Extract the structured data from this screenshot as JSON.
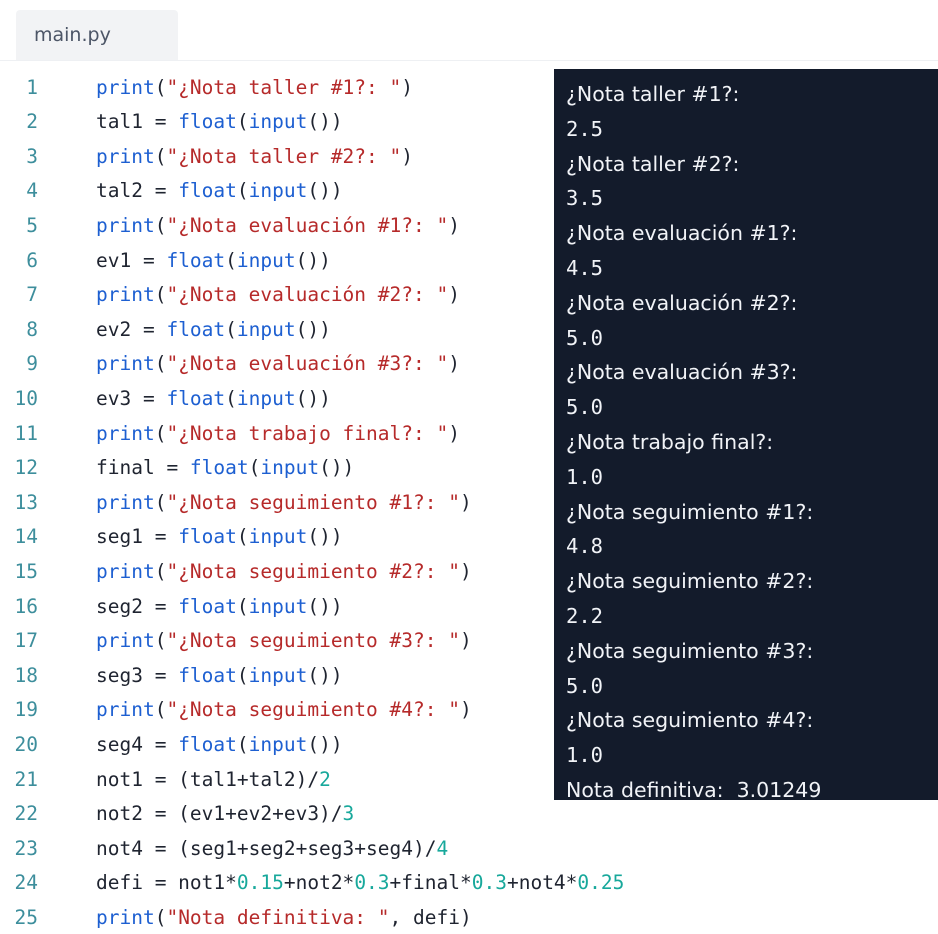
{
  "tab": {
    "filename": "main.py"
  },
  "editor": {
    "lines": [
      {
        "n": "1",
        "code": [
          {
            "t": "print",
            "c": "f"
          },
          {
            "t": "(",
            "c": ""
          },
          {
            "t": "\"¿Nota taller #1?: \"",
            "c": "s"
          },
          {
            "t": ")",
            "c": ""
          }
        ]
      },
      {
        "n": "2",
        "code": [
          {
            "t": "tal1 = ",
            "c": ""
          },
          {
            "t": "float",
            "c": "f"
          },
          {
            "t": "(",
            "c": ""
          },
          {
            "t": "input",
            "c": "f"
          },
          {
            "t": "())",
            "c": ""
          }
        ]
      },
      {
        "n": "3",
        "code": [
          {
            "t": "print",
            "c": "f"
          },
          {
            "t": "(",
            "c": ""
          },
          {
            "t": "\"¿Nota taller #2?: \"",
            "c": "s"
          },
          {
            "t": ")",
            "c": ""
          }
        ]
      },
      {
        "n": "4",
        "code": [
          {
            "t": "tal2 = ",
            "c": ""
          },
          {
            "t": "float",
            "c": "f"
          },
          {
            "t": "(",
            "c": ""
          },
          {
            "t": "input",
            "c": "f"
          },
          {
            "t": "())",
            "c": ""
          }
        ]
      },
      {
        "n": "5",
        "code": [
          {
            "t": "print",
            "c": "f"
          },
          {
            "t": "(",
            "c": ""
          },
          {
            "t": "\"¿Nota evaluación #1?: \"",
            "c": "s"
          },
          {
            "t": ")",
            "c": ""
          }
        ]
      },
      {
        "n": "6",
        "code": [
          {
            "t": "ev1 = ",
            "c": ""
          },
          {
            "t": "float",
            "c": "f"
          },
          {
            "t": "(",
            "c": ""
          },
          {
            "t": "input",
            "c": "f"
          },
          {
            "t": "())",
            "c": ""
          }
        ]
      },
      {
        "n": "7",
        "code": [
          {
            "t": "print",
            "c": "f"
          },
          {
            "t": "(",
            "c": ""
          },
          {
            "t": "\"¿Nota evaluación #2?: \"",
            "c": "s"
          },
          {
            "t": ")",
            "c": ""
          }
        ]
      },
      {
        "n": "8",
        "code": [
          {
            "t": "ev2 = ",
            "c": ""
          },
          {
            "t": "float",
            "c": "f"
          },
          {
            "t": "(",
            "c": ""
          },
          {
            "t": "input",
            "c": "f"
          },
          {
            "t": "())",
            "c": ""
          }
        ]
      },
      {
        "n": "9",
        "code": [
          {
            "t": "print",
            "c": "f"
          },
          {
            "t": "(",
            "c": ""
          },
          {
            "t": "\"¿Nota evaluación #3?: \"",
            "c": "s"
          },
          {
            "t": ")",
            "c": ""
          }
        ]
      },
      {
        "n": "10",
        "code": [
          {
            "t": "ev3 = ",
            "c": ""
          },
          {
            "t": "float",
            "c": "f"
          },
          {
            "t": "(",
            "c": ""
          },
          {
            "t": "input",
            "c": "f"
          },
          {
            "t": "())",
            "c": ""
          }
        ]
      },
      {
        "n": "11",
        "code": [
          {
            "t": "print",
            "c": "f"
          },
          {
            "t": "(",
            "c": ""
          },
          {
            "t": "\"¿Nota trabajo final?: \"",
            "c": "s"
          },
          {
            "t": ")",
            "c": ""
          }
        ]
      },
      {
        "n": "12",
        "code": [
          {
            "t": "final = ",
            "c": ""
          },
          {
            "t": "float",
            "c": "f"
          },
          {
            "t": "(",
            "c": ""
          },
          {
            "t": "input",
            "c": "f"
          },
          {
            "t": "())",
            "c": ""
          }
        ]
      },
      {
        "n": "13",
        "code": [
          {
            "t": "print",
            "c": "f"
          },
          {
            "t": "(",
            "c": ""
          },
          {
            "t": "\"¿Nota seguimiento #1?: \"",
            "c": "s"
          },
          {
            "t": ")",
            "c": ""
          }
        ]
      },
      {
        "n": "14",
        "code": [
          {
            "t": "seg1 = ",
            "c": ""
          },
          {
            "t": "float",
            "c": "f"
          },
          {
            "t": "(",
            "c": ""
          },
          {
            "t": "input",
            "c": "f"
          },
          {
            "t": "())",
            "c": ""
          }
        ]
      },
      {
        "n": "15",
        "code": [
          {
            "t": "print",
            "c": "f"
          },
          {
            "t": "(",
            "c": ""
          },
          {
            "t": "\"¿Nota seguimiento #2?: \"",
            "c": "s"
          },
          {
            "t": ")",
            "c": ""
          }
        ]
      },
      {
        "n": "16",
        "code": [
          {
            "t": "seg2 = ",
            "c": ""
          },
          {
            "t": "float",
            "c": "f"
          },
          {
            "t": "(",
            "c": ""
          },
          {
            "t": "input",
            "c": "f"
          },
          {
            "t": "())",
            "c": ""
          }
        ]
      },
      {
        "n": "17",
        "code": [
          {
            "t": "print",
            "c": "f"
          },
          {
            "t": "(",
            "c": ""
          },
          {
            "t": "\"¿Nota seguimiento #3?: \"",
            "c": "s"
          },
          {
            "t": ")",
            "c": ""
          }
        ]
      },
      {
        "n": "18",
        "code": [
          {
            "t": "seg3 = ",
            "c": ""
          },
          {
            "t": "float",
            "c": "f"
          },
          {
            "t": "(",
            "c": ""
          },
          {
            "t": "input",
            "c": "f"
          },
          {
            "t": "())",
            "c": ""
          }
        ]
      },
      {
        "n": "19",
        "code": [
          {
            "t": "print",
            "c": "f"
          },
          {
            "t": "(",
            "c": ""
          },
          {
            "t": "\"¿Nota seguimiento #4?: \"",
            "c": "s"
          },
          {
            "t": ")",
            "c": ""
          }
        ]
      },
      {
        "n": "20",
        "code": [
          {
            "t": "seg4 = ",
            "c": ""
          },
          {
            "t": "float",
            "c": "f"
          },
          {
            "t": "(",
            "c": ""
          },
          {
            "t": "input",
            "c": "f"
          },
          {
            "t": "())",
            "c": ""
          }
        ]
      },
      {
        "n": "21",
        "code": [
          {
            "t": "not1 = (tal1+tal2)/",
            "c": ""
          },
          {
            "t": "2",
            "c": "n"
          }
        ]
      },
      {
        "n": "22",
        "code": [
          {
            "t": "not2 = (ev1+ev2+ev3)/",
            "c": ""
          },
          {
            "t": "3",
            "c": "n"
          }
        ]
      },
      {
        "n": "23",
        "code": [
          {
            "t": "not4 = (seg1+seg2+seg3+seg4)/",
            "c": ""
          },
          {
            "t": "4",
            "c": "n"
          }
        ]
      },
      {
        "n": "24",
        "code": [
          {
            "t": "defi = not1*",
            "c": ""
          },
          {
            "t": "0.15",
            "c": "n"
          },
          {
            "t": "+not2*",
            "c": ""
          },
          {
            "t": "0.3",
            "c": "n"
          },
          {
            "t": "+final*",
            "c": ""
          },
          {
            "t": "0.3",
            "c": "n"
          },
          {
            "t": "+not4*",
            "c": ""
          },
          {
            "t": "0.25",
            "c": "n"
          }
        ]
      },
      {
        "n": "25",
        "code": [
          {
            "t": "print",
            "c": "f"
          },
          {
            "t": "(",
            "c": ""
          },
          {
            "t": "\"Nota definitiva: \"",
            "c": "s"
          },
          {
            "t": ", defi)",
            "c": ""
          }
        ]
      }
    ]
  },
  "console": {
    "lines": [
      "¿Nota taller #1?:",
      "2.5",
      "¿Nota taller #2?:",
      "3.5",
      "¿Nota evaluación #1?:",
      "4.5",
      "¿Nota evaluación #2?:",
      "5.0",
      "¿Nota evaluación #3?:",
      "5.0",
      "¿Nota trabajo final?:",
      "1.0",
      "¿Nota seguimiento #1?:",
      "4.8",
      "¿Nota seguimiento #2?:",
      "2.2",
      "¿Nota seguimiento #3?:",
      "5.0",
      "¿Nota seguimiento #4?:",
      "1.0",
      "Nota definitiva:  3.01249"
    ]
  }
}
